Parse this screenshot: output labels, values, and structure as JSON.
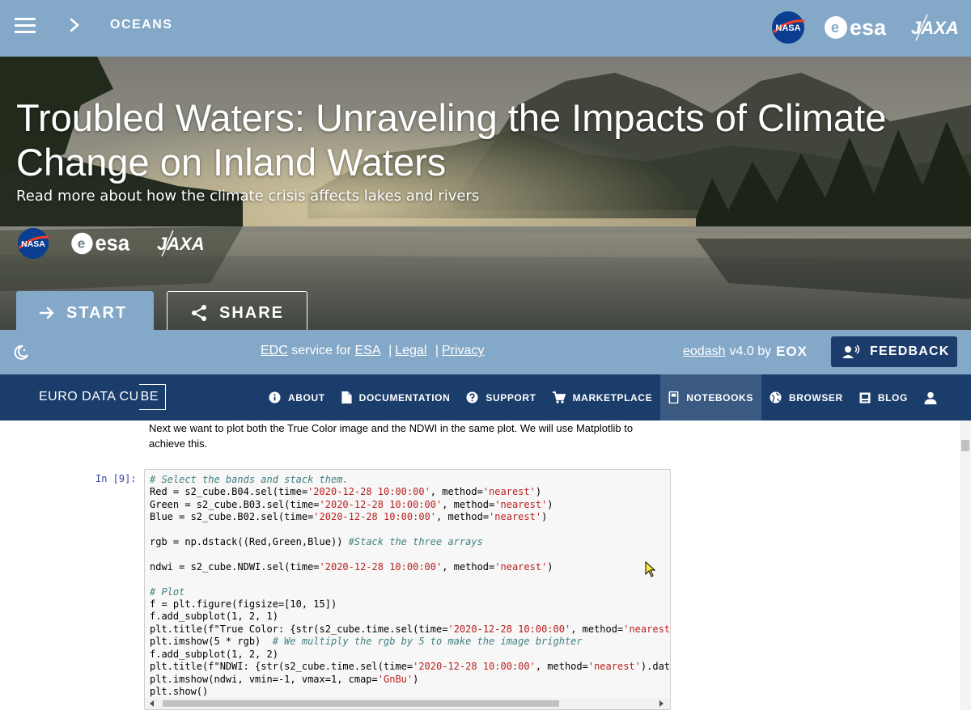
{
  "topbar": {
    "breadcrumb": "OCEANS",
    "logos": [
      "NASA",
      "esa",
      "JAXA"
    ]
  },
  "hero": {
    "title": "Troubled Waters: Unraveling the Impacts of Climate Change on Inland Waters",
    "subtitle": "Read more about how the climate crisis affects lakes and rivers",
    "logos": {
      "nasa": "NASA",
      "esa": "esa",
      "jaxa": "JAXA"
    },
    "start_label": "START",
    "share_label": "SHARE"
  },
  "footer": {
    "edc": "EDC",
    "service_for": "service for",
    "esa": "ESA",
    "legal": "Legal",
    "privacy": "Privacy",
    "eodash": "eodash",
    "version": "v4.0 by",
    "eox": "EOX",
    "feedback_label": "FEEDBACK"
  },
  "edc_nav": {
    "logo_part1": "EURO DATA CU",
    "logo_part2": "BE",
    "items": [
      {
        "label": "ABOUT",
        "icon": "info-icon"
      },
      {
        "label": "DOCUMENTATION",
        "icon": "document-icon"
      },
      {
        "label": "SUPPORT",
        "icon": "help-icon"
      },
      {
        "label": "MARKETPLACE",
        "icon": "cart-icon"
      },
      {
        "label": "NOTEBOOKS",
        "icon": "notebook-icon",
        "active": true
      },
      {
        "label": "BROWSER",
        "icon": "globe-icon"
      },
      {
        "label": "BLOG",
        "icon": "blog-icon"
      }
    ]
  },
  "notebook": {
    "markdown": "Next we want to plot both the True Color image and the NDWI in the same plot. We will use Matplotlib to achieve this.",
    "prompt": "In [9]:",
    "code_lines": [
      "# Select the bands and stack them.",
      "Red = s2_cube.B04.sel(time='2020-12-28 10:00:00', method='nearest')",
      "Green = s2_cube.B03.sel(time='2020-12-28 10:00:00', method='nearest')",
      "Blue = s2_cube.B02.sel(time='2020-12-28 10:00:00', method='nearest')",
      "",
      "rgb = np.dstack((Red,Green,Blue)) #Stack the three arrays",
      "",
      "ndwi = s2_cube.NDWI.sel(time='2020-12-28 10:00:00', method='nearest')",
      "",
      "# Plot",
      "f = plt.figure(figsize=[10, 15])",
      "f.add_subplot(1, 2, 1)",
      "plt.title(f\"True Color: {str(s2_cube.time.sel(time='2020-12-28 10:00:00', method='nearest').",
      "plt.imshow(5 * rgb)  # We multiply the rgb by 5 to make the image brighter",
      "f.add_subplot(1, 2, 2)",
      "plt.title(f\"NDWI: {str(s2_cube.time.sel(time='2020-12-28 10:00:00', method='nearest').data).",
      "plt.imshow(ndwi, vmin=-1, vmax=1, cmap='GnBu')",
      "plt.show()"
    ]
  },
  "colors": {
    "accent": "#84a8c8",
    "navy": "#1b3d6c",
    "feedback": "#1c3c6b"
  }
}
